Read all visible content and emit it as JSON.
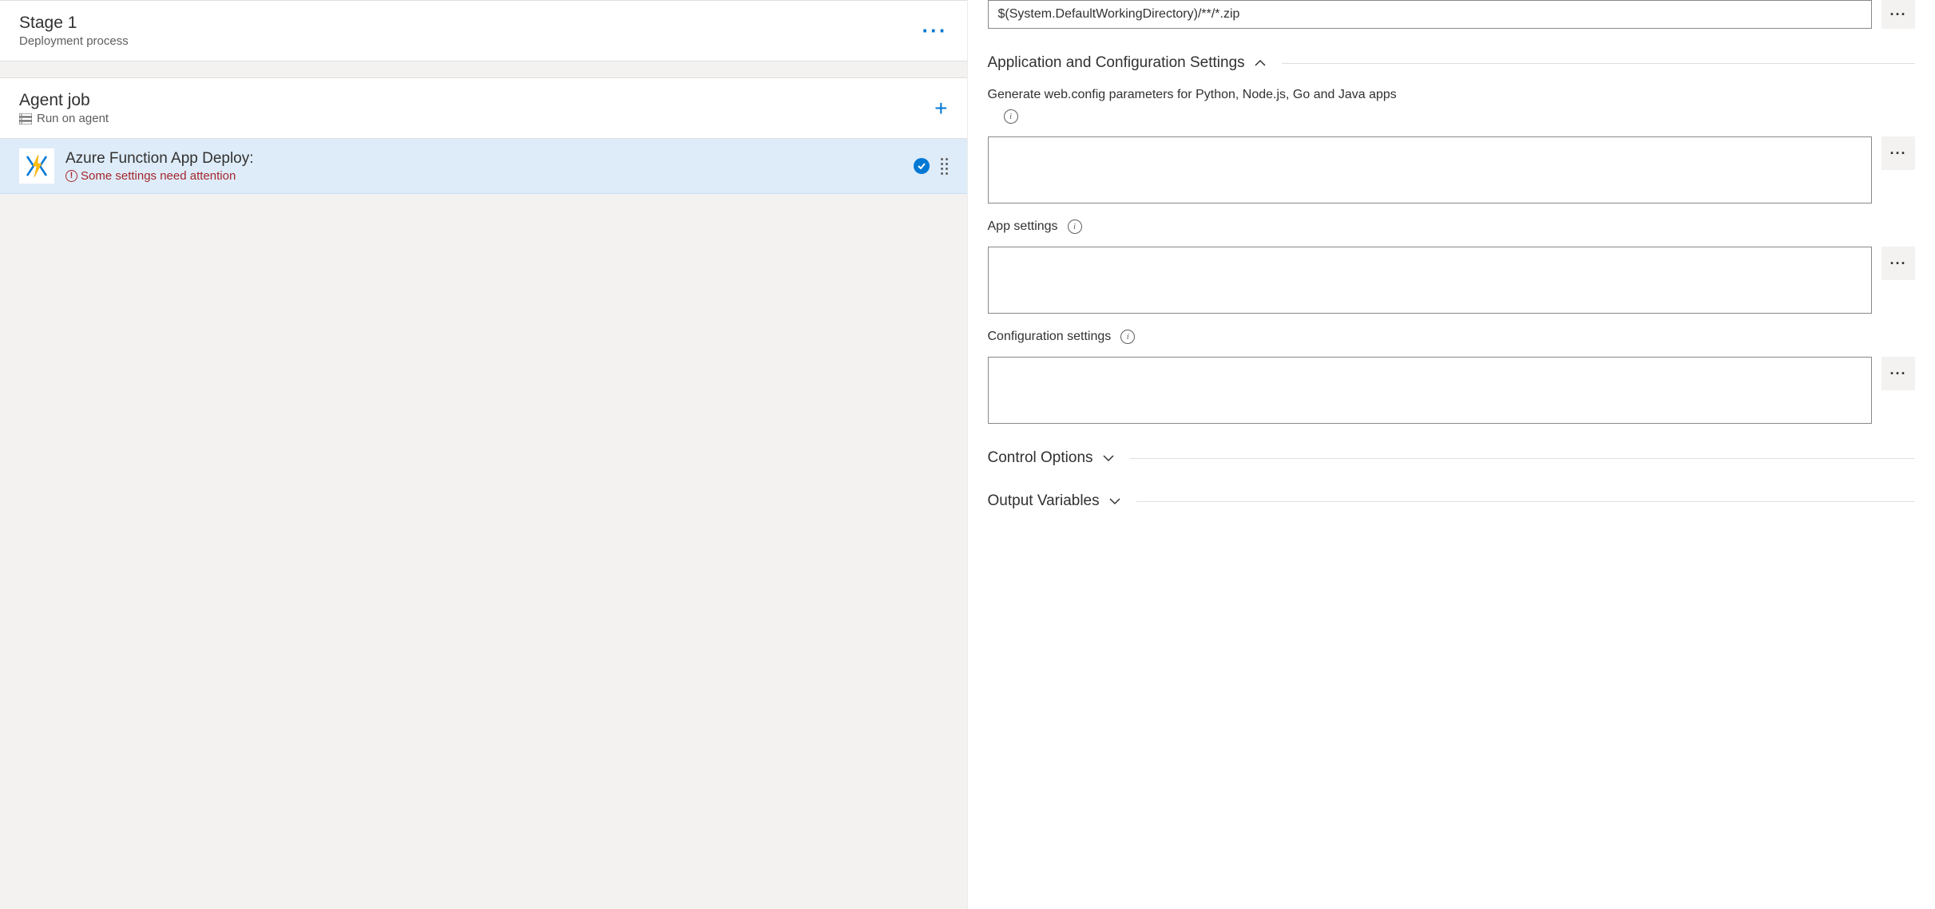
{
  "leftPanel": {
    "stage": {
      "title": "Stage 1",
      "subtitle": "Deployment process"
    },
    "agentJob": {
      "title": "Agent job",
      "subtitle": "Run on agent"
    },
    "task": {
      "title": "Azure Function App Deploy:",
      "warning": "Some settings need attention"
    }
  },
  "rightPanel": {
    "packagePath": "$(System.DefaultWorkingDirectory)/**/*.zip",
    "sections": {
      "appConfig": {
        "title": "Application and Configuration Settings",
        "webConfigLabel": "Generate web.config parameters for Python, Node.js, Go and Java apps",
        "webConfigValue": "",
        "appSettingsLabel": "App settings",
        "appSettingsValue": "",
        "configSettingsLabel": "Configuration settings",
        "configSettingsValue": ""
      },
      "controlOptions": {
        "title": "Control Options"
      },
      "outputVariables": {
        "title": "Output Variables"
      }
    }
  }
}
